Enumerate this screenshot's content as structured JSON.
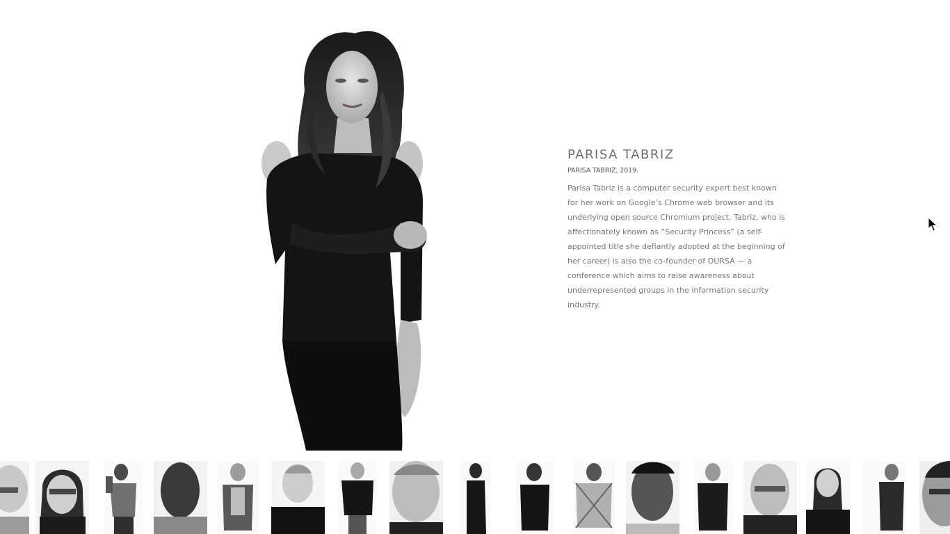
{
  "profile": {
    "name": "PARISA TABRIZ",
    "caption": "PARISA TABRIZ, 2019.",
    "bio": "Parisa Tabriz is a computer security expert best known for her work on Google’s Chrome web browser and its underlying open source Chromium project. Tabriz, who is affectionately known as “Security Princess” (a self-appointed title she defiantly adopted at the beginning of her career) is also the co-founder of OURSA — a conference which aims to raise awareness about underrepresented groups in the information security industry."
  },
  "portrait_strip": {
    "count": 17,
    "style": "black-and-white portraits"
  }
}
